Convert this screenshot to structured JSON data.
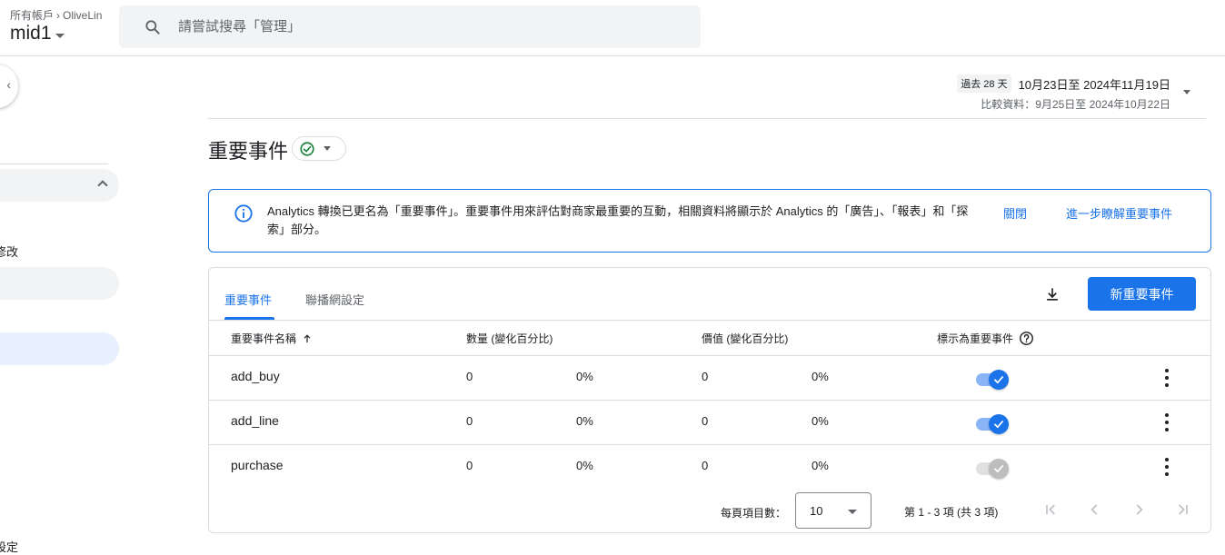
{
  "header": {
    "breadcrumb_root": "所有帳戶",
    "breadcrumb_account": "OliveLin",
    "property": "mid1",
    "search_placeholder": "請嘗試搜尋「管理」"
  },
  "sidebar": {
    "partial_text_1": "修改",
    "partial_text_2": "設定"
  },
  "daterange": {
    "chip": "過去 28 天",
    "range": "10月23日至 2024年11月19日",
    "compare": "比較資料：9月25日至 2024年10月22日"
  },
  "page": {
    "title": "重要事件"
  },
  "banner": {
    "message": "Analytics 轉換已更名為「重要事件」。重要事件用來評估對商家最重要的互動，相關資料將顯示於 Analytics 的「廣告」、「報表」和「探索」部分。",
    "dismiss_label": "關閉",
    "learn_more_label": "進一步瞭解重要事件"
  },
  "tabs": [
    {
      "label": "重要事件",
      "active": true
    },
    {
      "label": "聯播網設定",
      "active": false
    }
  ],
  "toolbar": {
    "new_button_label": "新重要事件"
  },
  "table": {
    "columns": [
      "重要事件名稱",
      "數量 (變化百分比)",
      "價值 (變化百分比)",
      "標示為重要事件"
    ],
    "rows": [
      {
        "name": "add_buy",
        "count": "0",
        "count_change": "0%",
        "value": "0",
        "value_change": "0%",
        "key_event": true,
        "toggle_enabled": true
      },
      {
        "name": "add_line",
        "count": "0",
        "count_change": "0%",
        "value": "0",
        "value_change": "0%",
        "key_event": true,
        "toggle_enabled": true
      },
      {
        "name": "purchase",
        "count": "0",
        "count_change": "0%",
        "value": "0",
        "value_change": "0%",
        "key_event": true,
        "toggle_enabled": false
      }
    ]
  },
  "pagination": {
    "rows_per_page_label": "每頁項目數：",
    "rows_per_page_value": "10",
    "range_text": "第 1 - 3 項 (共 3 項)"
  },
  "colors": {
    "accent": "#1a73e8",
    "success": "#188038"
  }
}
